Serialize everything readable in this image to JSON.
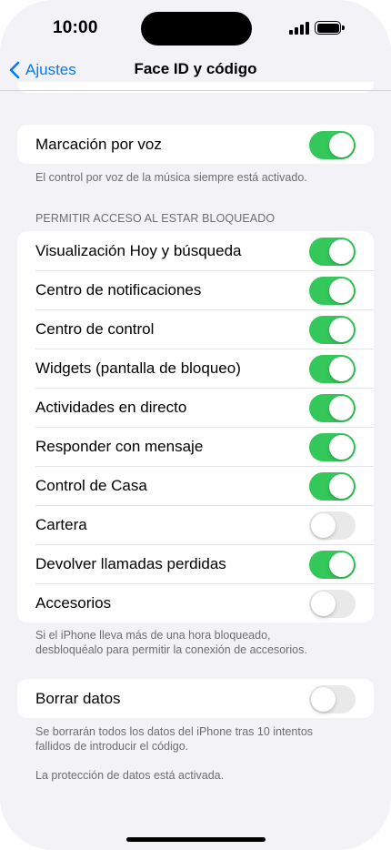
{
  "status_bar": {
    "time": "10:00"
  },
  "nav": {
    "back_label": "Ajustes",
    "title": "Face ID y código"
  },
  "voice_dial": {
    "label": "Marcación por voz",
    "on": true,
    "footer": "El control por voz de la música siempre está activado."
  },
  "locked_access": {
    "header": "PERMITIR ACCESO AL ESTAR BLOQUEADO",
    "items": [
      {
        "label": "Visualización Hoy y búsqueda",
        "on": true
      },
      {
        "label": "Centro de notificaciones",
        "on": true
      },
      {
        "label": "Centro de control",
        "on": true
      },
      {
        "label": "Widgets (pantalla de bloqueo)",
        "on": true
      },
      {
        "label": "Actividades en directo",
        "on": true
      },
      {
        "label": "Responder con mensaje",
        "on": true
      },
      {
        "label": "Control de Casa",
        "on": true
      },
      {
        "label": "Cartera",
        "on": false
      },
      {
        "label": "Devolver llamadas perdidas",
        "on": true
      },
      {
        "label": "Accesorios",
        "on": false
      }
    ],
    "footer_line1": "Si el iPhone lleva más de una hora bloqueado,",
    "footer_line2": "desbloquéalo para permitir la conexión de accesorios."
  },
  "erase": {
    "label": "Borrar datos",
    "on": false,
    "footer_line1": "Se borrarán todos los datos del iPhone tras 10 intentos",
    "footer_line2": "fallidos de introducir el código.",
    "protection_note": "La protección de datos está activada."
  },
  "colors": {
    "accent": "#007aff",
    "toggle_on": "#34c759",
    "toggle_off": "#e9e9ea"
  }
}
